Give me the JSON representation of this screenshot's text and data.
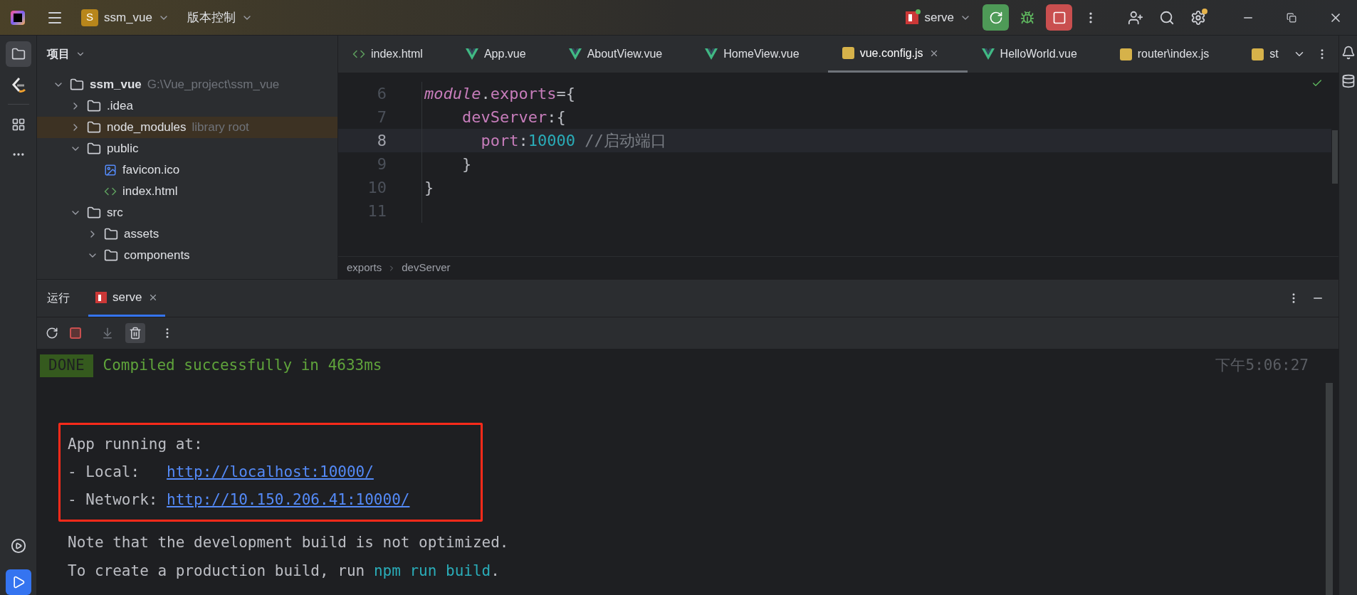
{
  "title_bar": {
    "project_badge": "S",
    "project": "ssm_vue",
    "vcs": "版本控制",
    "run_config": "serve"
  },
  "project_panel": {
    "title": "项目",
    "tree": [
      {
        "name": "ssm_vue",
        "hint": "G:\\Vue_project\\ssm_vue",
        "kind": "project",
        "expanded": true,
        "selected": false,
        "children": [
          {
            "name": ".idea",
            "kind": "folder",
            "expanded": false,
            "selected": false
          },
          {
            "name": "node_modules",
            "hint": "library root",
            "kind": "folder",
            "expanded": false,
            "selected": true
          },
          {
            "name": "public",
            "kind": "folder",
            "expanded": true,
            "selected": false,
            "children": [
              {
                "name": "favicon.ico",
                "kind": "image",
                "selected": false
              },
              {
                "name": "index.html",
                "kind": "html",
                "selected": false
              }
            ]
          },
          {
            "name": "src",
            "kind": "folder",
            "expanded": true,
            "selected": false,
            "children": [
              {
                "name": "assets",
                "kind": "folder",
                "expanded": false,
                "selected": false
              },
              {
                "name": "components",
                "kind": "folder",
                "expanded": true,
                "selected": false
              }
            ]
          }
        ]
      }
    ]
  },
  "editor_tabs": [
    {
      "label": "index.html",
      "kind": "html",
      "selected": false
    },
    {
      "label": "App.vue",
      "kind": "vue",
      "selected": false
    },
    {
      "label": "AboutView.vue",
      "kind": "vue",
      "selected": false
    },
    {
      "label": "HomeView.vue",
      "kind": "vue",
      "selected": false
    },
    {
      "label": "vue.config.js",
      "kind": "js",
      "selected": true
    },
    {
      "label": "HelloWorld.vue",
      "kind": "vue",
      "selected": false
    },
    {
      "label": "router\\index.js",
      "kind": "js",
      "selected": false
    },
    {
      "label": "st",
      "kind": "js",
      "selected": false
    }
  ],
  "code_lines": [
    {
      "number": "6",
      "current": false,
      "tokens": [
        {
          "text": "module",
          "kind": "italic"
        },
        {
          "text": ".",
          "kind": "plain"
        },
        {
          "text": "exports",
          "kind": "property"
        },
        {
          "text": "={",
          "kind": "plain"
        }
      ]
    },
    {
      "number": "7",
      "current": false,
      "tokens": [
        {
          "text": "    devServer",
          "kind": "property"
        },
        {
          "text": ":{",
          "kind": "plain"
        }
      ]
    },
    {
      "number": "8",
      "current": true,
      "tokens": [
        {
          "text": "      port",
          "kind": "property"
        },
        {
          "text": ":",
          "kind": "plain"
        },
        {
          "text": "10000",
          "kind": "number"
        },
        {
          "text": " //启动端口",
          "kind": "comment"
        }
      ]
    },
    {
      "number": "9",
      "current": false,
      "tokens": [
        {
          "text": "    }",
          "kind": "plain"
        }
      ]
    },
    {
      "number": "10",
      "current": false,
      "tokens": [
        {
          "text": "}",
          "kind": "plain"
        }
      ]
    },
    {
      "number": "11",
      "current": false
    }
  ],
  "breadcrumb": [
    "exports",
    "devServer"
  ],
  "run_panel": {
    "title": "运行",
    "tabs": [
      {
        "label": "serve",
        "selected": true
      }
    ],
    "console": {
      "badge": "DONE",
      "message": "Compiled successfully in 4633ms",
      "time": "下午5:06:27",
      "boxed_lines": [
        {
          "text": "App running at:"
        },
        {
          "text": "- Local:   ",
          "link": "http://localhost:10000/"
        },
        {
          "text": "- Network: ",
          "link": "http://10.150.206.41:10000/"
        }
      ],
      "lines": [
        {
          "parts": [
            {
              "text": "Note that the development build is not optimized.",
              "kind": "plain"
            }
          ]
        },
        {
          "parts": [
            {
              "text": "To create a production build, run ",
              "kind": "plain"
            },
            {
              "text": "npm run build",
              "kind": "command"
            },
            {
              "text": ".",
              "kind": "plain"
            }
          ]
        }
      ]
    }
  }
}
